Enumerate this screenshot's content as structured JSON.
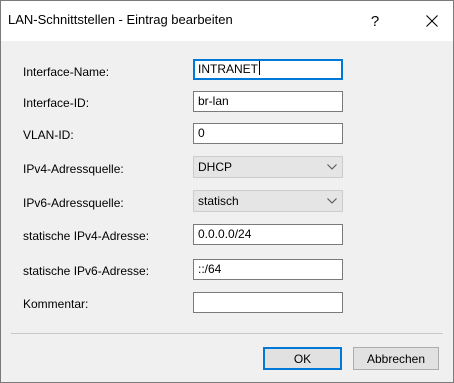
{
  "window": {
    "title": "LAN-Schnittstellen - Eintrag bearbeiten",
    "help_label": "?",
    "close_icon": "close-icon"
  },
  "form": {
    "interface_name": {
      "label": "Interface-Name:",
      "value": "INTRANET",
      "focused": true
    },
    "interface_id": {
      "label": "Interface-ID:",
      "value": "br-lan"
    },
    "vlan_id": {
      "label": "VLAN-ID:",
      "value": "0"
    },
    "ipv4_source": {
      "label": "IPv4-Adressquelle:",
      "value": "DHCP"
    },
    "ipv6_source": {
      "label": "IPv6-Adressquelle:",
      "value": "statisch"
    },
    "static_ipv4": {
      "label": "statische IPv4-Adresse:",
      "value": "0.0.0.0/24"
    },
    "static_ipv6": {
      "label": "statische IPv6-Adresse:",
      "value": "::/64"
    },
    "comment": {
      "label": "Kommentar:",
      "value": ""
    }
  },
  "buttons": {
    "ok_label": "OK",
    "cancel_label": "Abbrechen"
  },
  "colors": {
    "dialog_background": "#f0f0f0",
    "titlebar_background": "#ffffff",
    "focus_accent": "#0078d7"
  }
}
